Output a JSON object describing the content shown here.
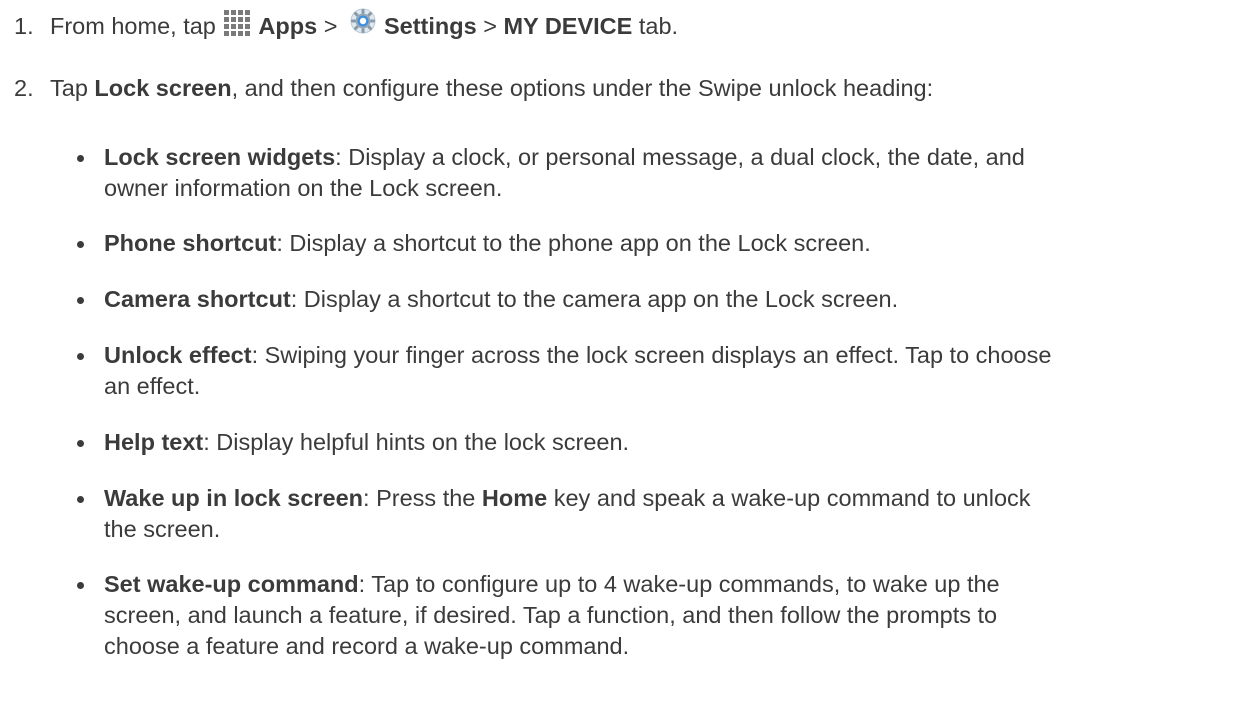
{
  "step1": {
    "number": "1.",
    "prefix": "From home, tap",
    "apps_label": "Apps",
    "sep1": ">",
    "settings_label": "Settings",
    "sep2": ">",
    "tab_label": "MY DEVICE",
    "suffix": "tab.",
    "icons": [
      "apps-grid-icon",
      "settings-gear-icon"
    ]
  },
  "step2": {
    "number": "2.",
    "prefix": "Tap",
    "lock_screen": "Lock screen",
    "suffix": ", and then configure these options under the Swipe unlock heading:"
  },
  "options": [
    {
      "term": "Lock screen widgets",
      "line1": ": Display a clock, or personal message, a dual clock, the date, and",
      "line2": "owner information on the Lock screen."
    },
    {
      "term": "Phone shortcut",
      "line1": ": Display a shortcut to the phone app on the Lock screen."
    },
    {
      "term": "Camera shortcut",
      "line1": ": Display a shortcut to the camera app on the Lock screen."
    },
    {
      "term": "Unlock effect",
      "line1": ": Swiping your finger across the lock screen displays an effect. Tap to choose",
      "line2": "an effect."
    },
    {
      "term": "Help text",
      "line1": ": Display helpful hints on the lock screen."
    },
    {
      "term": "Wake up in lock screen",
      "line1_a": ": Press the ",
      "home_key": "Home",
      "line1_b": " key and speak a wake-up command to unlock",
      "line2": "the screen."
    },
    {
      "term": "Set wake-up command",
      "line1": ": Tap to configure up to 4 wake-up commands, to wake up the",
      "line2": "screen, and launch a feature, if desired. Tap a function, and then follow the prompts to",
      "line3": "choose a feature and record a wake-up command."
    }
  ]
}
